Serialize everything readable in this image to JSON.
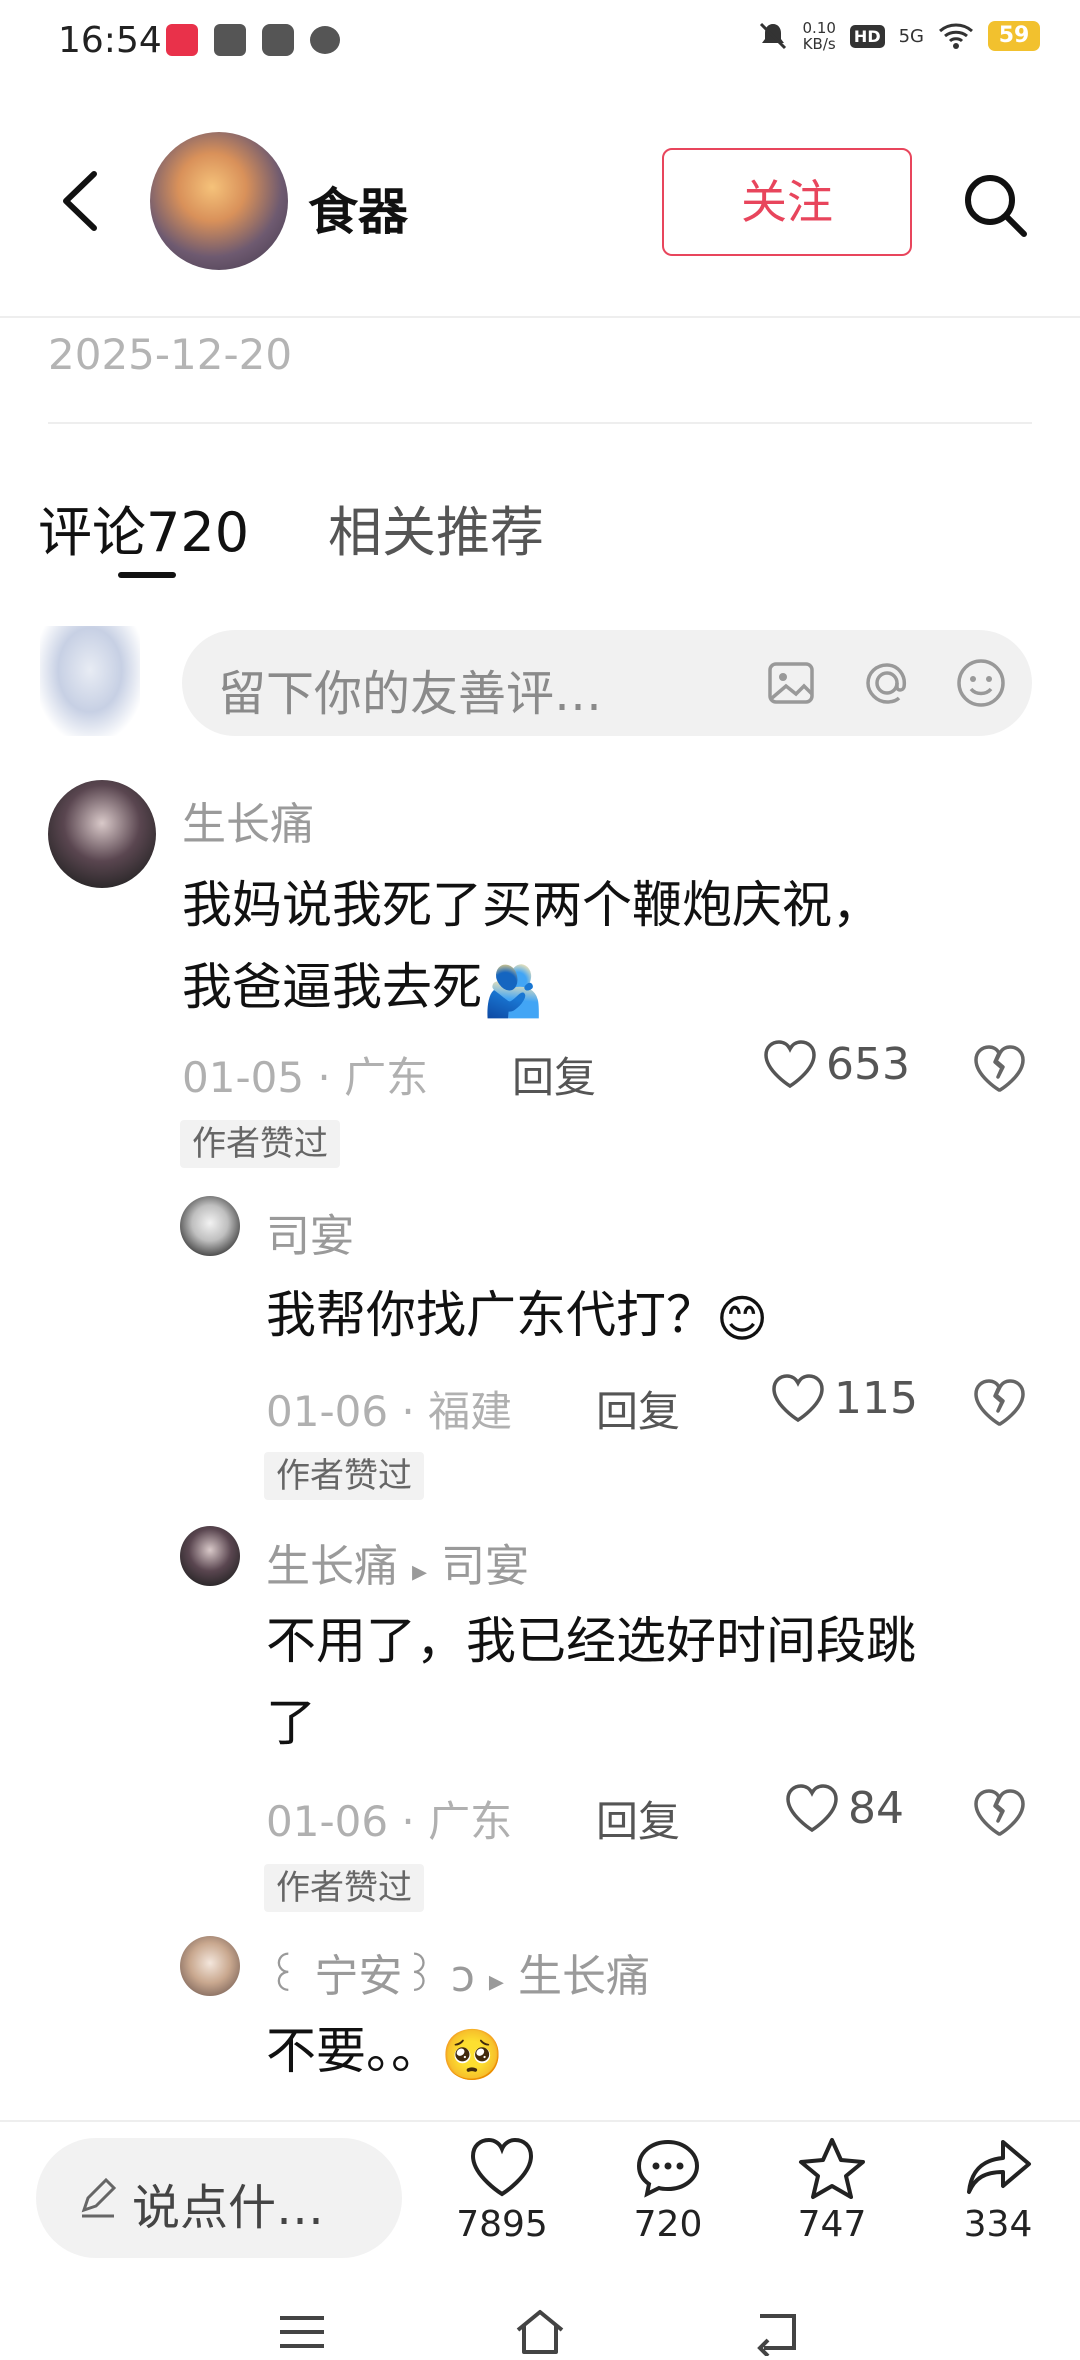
{
  "status_bar": {
    "time": "16:54",
    "net_speed_value": "0.10",
    "net_speed_unit": "KB/s",
    "hd": "HD",
    "signal": "5G",
    "battery": "59"
  },
  "header": {
    "title": "食器",
    "follow_label": "关注"
  },
  "post": {
    "date": "2025-12-20"
  },
  "tabs": [
    {
      "label": "评论720"
    },
    {
      "label": "相关推荐"
    }
  ],
  "comment_input": {
    "placeholder": "留下你的友善评…"
  },
  "comments": [
    {
      "author": "生长痛",
      "lines": [
        "我妈说我死了买两个鞭炮庆祝，",
        "我爸逼我去死"
      ],
      "emoji": "🫂",
      "date": "01-05",
      "location": "广东",
      "reply_label": "回复",
      "likes": "653",
      "badge": "作者赞过"
    },
    {
      "author": "司宴",
      "lines": [
        "我帮你找广东代打？"
      ],
      "emoji": "😊",
      "date": "01-06",
      "location": "福建",
      "reply_label": "回复",
      "likes": "115",
      "badge": "作者赞过"
    },
    {
      "author": "生长痛",
      "reply_to": "司宴",
      "lines": [
        "不用了，我已经选好时间段跳",
        "了"
      ],
      "date": "01-06",
      "location": "广东",
      "reply_label": "回复",
      "likes": "84",
      "badge": "作者赞过"
    },
    {
      "author": "꒰ 宁安꒱ ",
      "author_suffix": "ɔ",
      "reply_to": "生长痛",
      "lines": [
        "不要。。"
      ],
      "emoji": "🥺"
    }
  ],
  "bottom_bar": {
    "input_label": "说点什…",
    "likes": "7895",
    "comments": "720",
    "favorites": "747",
    "shares": "334"
  },
  "colors": {
    "accent": "#e8455c",
    "muted_text": "#9a9a9a"
  }
}
